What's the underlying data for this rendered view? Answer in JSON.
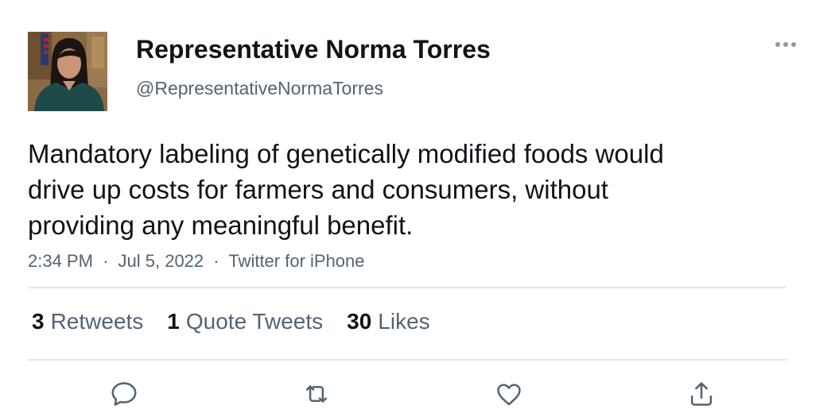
{
  "author": {
    "display_name": "Representative Norma Torres",
    "handle": "@RepresentativeNormaTorres"
  },
  "tweet": {
    "text": "Mandatory labeling of genetically modified foods would\ndrive up costs for farmers and consumers, without\nproviding any meaningful benefit.",
    "time": "2:34 PM",
    "date": "Jul 5, 2022",
    "source": "Twitter for iPhone",
    "separator": "·"
  },
  "stats": {
    "retweets_count": "3",
    "retweets_label": "Retweets",
    "quotes_count": "1",
    "quotes_label": "Quote Tweets",
    "likes_count": "30",
    "likes_label": "Likes"
  },
  "icons": {
    "more": "more-icon",
    "reply": "reply-icon",
    "retweet": "retweet-icon",
    "like": "like-icon",
    "share": "share-icon"
  },
  "colors": {
    "text_primary": "#0f1419",
    "text_secondary": "#536471",
    "divider": "#e2e6e9"
  }
}
